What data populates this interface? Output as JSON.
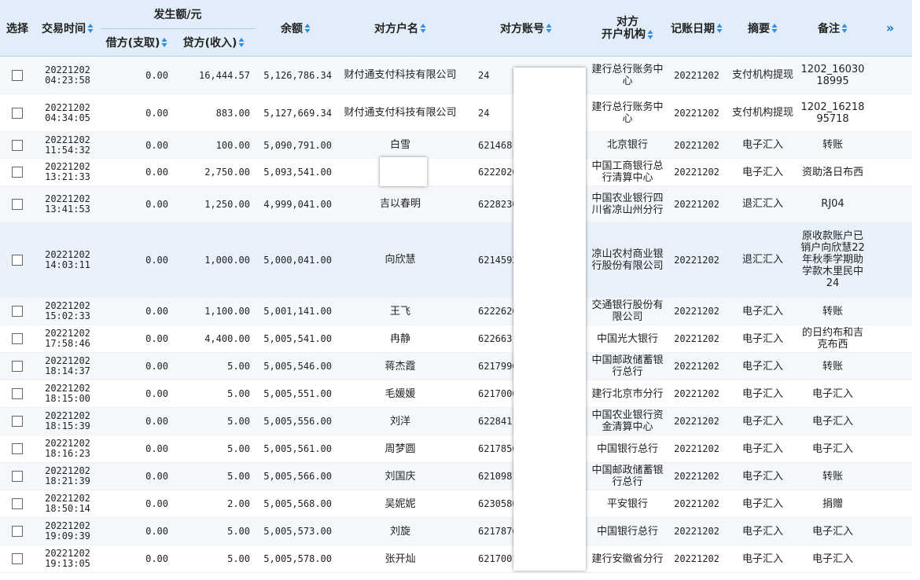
{
  "header": {
    "select": "选择",
    "time": "交易时间",
    "amount_group": "发生额/元",
    "debit": "借方(支取)",
    "credit": "贷方(收入)",
    "balance": "余额",
    "counterparty_name": "对方户名",
    "counterparty_account": "对方账号",
    "institution_line1": "对方",
    "institution_line2": "开户机构",
    "posting_date": "记账日期",
    "summary": "摘要",
    "remark": "备注",
    "more": "»"
  },
  "colors": {
    "header_bg": "#e1edf8",
    "sort_arrow": "#2f8ee0",
    "row_alt": "#f4f7fb"
  },
  "rows": [
    {
      "date": "20221202",
      "time": "04:23:58",
      "debit": "0.00",
      "credit": "16,444.57",
      "balance": "5,126,786.34",
      "name": "财付通支付科技有限公司",
      "account": "24",
      "institution": "建行总行账务中心",
      "posting": "20221202",
      "summary": "支付机构提现",
      "remark": "1202_1603018995"
    },
    {
      "date": "20221202",
      "time": "04:34:05",
      "debit": "0.00",
      "credit": "883.00",
      "balance": "5,127,669.34",
      "name": "财付通支付科技有限公司",
      "account": "24",
      "institution": "建行总行账务中心",
      "posting": "20221202",
      "summary": "支付机构提现",
      "remark": "1202_1621895718"
    },
    {
      "date": "20221202",
      "time": "11:54:32",
      "debit": "0.00",
      "credit": "100.00",
      "balance": "5,090,791.00",
      "name": "白雪",
      "account": "621468",
      "institution": "北京银行",
      "posting": "20221202",
      "summary": "电子汇入",
      "remark": "转账"
    },
    {
      "date": "20221202",
      "time": "13:21:33",
      "debit": "0.00",
      "credit": "2,750.00",
      "balance": "5,093,541.00",
      "name": "",
      "account": "6222020",
      "institution": "中国工商银行总行清算中心",
      "posting": "20221202",
      "summary": "电子汇入",
      "remark": "资助洛日布西"
    },
    {
      "date": "20221202",
      "time": "13:41:53",
      "debit": "0.00",
      "credit": "1,250.00",
      "balance": "4,999,041.00",
      "name": "吉以春明",
      "account": "6228230",
      "institution": "中国农业银行四川省凉山州分行",
      "posting": "20221202",
      "summary": "退汇汇入",
      "remark": "RJ04"
    },
    {
      "date": "20221202",
      "time": "14:03:11",
      "debit": "0.00",
      "credit": "1,000.00",
      "balance": "5,000,041.00",
      "name": "向欣慧",
      "account": "6214592",
      "institution": "凉山农村商业银行股份有限公司",
      "posting": "20221202",
      "summary": "退汇汇入",
      "remark": "原收款账户已销户向欣慧22年秋季学期助学款木里民中24"
    },
    {
      "date": "20221202",
      "time": "15:02:33",
      "debit": "0.00",
      "credit": "1,100.00",
      "balance": "5,001,141.00",
      "name": "王飞",
      "account": "6222620",
      "institution": "交通银行股份有限公司",
      "posting": "20221202",
      "summary": "电子汇入",
      "remark": "转账"
    },
    {
      "date": "20221202",
      "time": "17:58:46",
      "debit": "0.00",
      "credit": "4,400.00",
      "balance": "5,005,541.00",
      "name": "冉静",
      "account": "622663",
      "institution": "中国光大银行",
      "posting": "20221202",
      "summary": "电子汇入",
      "remark": "的日约布和吉克布西"
    },
    {
      "date": "20221202",
      "time": "18:14:37",
      "debit": "0.00",
      "credit": "5.00",
      "balance": "5,005,546.00",
      "name": "蒋杰霞",
      "account": "6217996",
      "institution": "中国邮政储蓄银行总行",
      "posting": "20221202",
      "summary": "电子汇入",
      "remark": "转账"
    },
    {
      "date": "20221202",
      "time": "18:15:00",
      "debit": "0.00",
      "credit": "5.00",
      "balance": "5,005,551.00",
      "name": "毛媛媛",
      "account": "6217000",
      "institution": "建行北京市分行",
      "posting": "20221202",
      "summary": "电子汇入",
      "remark": "电子汇入"
    },
    {
      "date": "20221202",
      "time": "18:15:39",
      "debit": "0.00",
      "credit": "5.00",
      "balance": "5,005,556.00",
      "name": "刘洋",
      "account": "6228411",
      "institution": "中国农业银行资金清算中心",
      "posting": "20221202",
      "summary": "电子汇入",
      "remark": "电子汇入"
    },
    {
      "date": "20221202",
      "time": "18:16:23",
      "debit": "0.00",
      "credit": "5.00",
      "balance": "5,005,561.00",
      "name": "周梦圆",
      "account": "6217856",
      "institution": "中国银行总行",
      "posting": "20221202",
      "summary": "电子汇入",
      "remark": "电子汇入"
    },
    {
      "date": "20221202",
      "time": "18:21:39",
      "debit": "0.00",
      "credit": "5.00",
      "balance": "5,005,566.00",
      "name": "刘国庆",
      "account": "6210981",
      "institution": "中国邮政储蓄银行总行",
      "posting": "20221202",
      "summary": "电子汇入",
      "remark": "转账"
    },
    {
      "date": "20221202",
      "time": "18:50:14",
      "debit": "0.00",
      "credit": "2.00",
      "balance": "5,005,568.00",
      "name": "吴妮妮",
      "account": "6230580",
      "institution": "平安银行",
      "posting": "20221202",
      "summary": "电子汇入",
      "remark": "捐赠"
    },
    {
      "date": "20221202",
      "time": "19:09:39",
      "debit": "0.00",
      "credit": "5.00",
      "balance": "5,005,573.00",
      "name": "刘旋",
      "account": "6217876",
      "institution": "中国银行总行",
      "posting": "20221202",
      "summary": "电子汇入",
      "remark": "电子汇入"
    },
    {
      "date": "20221202",
      "time": "19:13:05",
      "debit": "0.00",
      "credit": "5.00",
      "balance": "5,005,578.00",
      "name": "张开灿",
      "account": "6217001",
      "institution": "建行安徽省分行",
      "posting": "20221202",
      "summary": "电子汇入",
      "remark": "电子汇入"
    }
  ]
}
